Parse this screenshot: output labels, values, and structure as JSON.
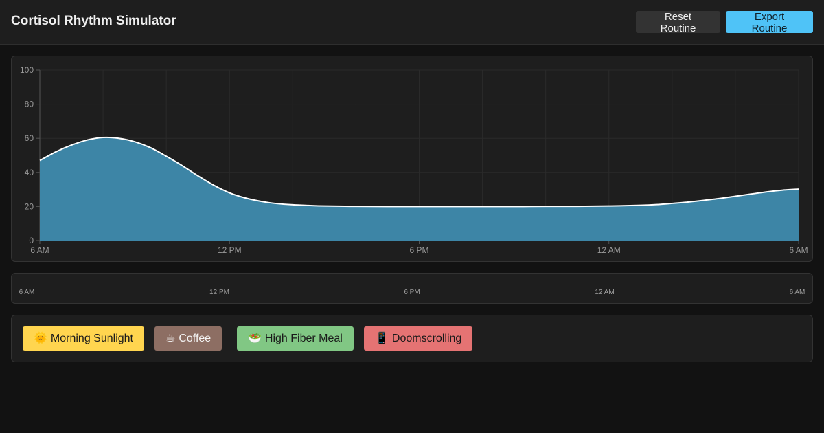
{
  "app": {
    "title": "Cortisol Rhythm Simulator"
  },
  "toolbar": {
    "reset_label": "Reset Routine",
    "export_label": "Export Routine"
  },
  "colors": {
    "accent": "#4fc3f7",
    "area_fill": "#3d85a6",
    "curve_stroke": "#ffffff",
    "sunlight": "#ffd54f",
    "coffee": "#8d6e63",
    "fiber": "#81c784",
    "doom": "#e57373"
  },
  "chart_data": {
    "type": "area",
    "title": "",
    "xlabel": "",
    "ylabel": "",
    "ylim": [
      0,
      100
    ],
    "yticks": [
      0,
      20,
      40,
      60,
      80,
      100
    ],
    "xlim": [
      0,
      24
    ],
    "xticks": [
      {
        "x": 0,
        "label": "6 AM"
      },
      {
        "x": 6,
        "label": "12 PM"
      },
      {
        "x": 12,
        "label": "6 PM"
      },
      {
        "x": 18,
        "label": "12 AM"
      },
      {
        "x": 24,
        "label": "6 AM"
      }
    ],
    "grid": true,
    "series": [
      {
        "x": [
          0,
          0.5,
          1,
          1.5,
          2,
          2.5,
          3,
          3.5,
          4,
          4.5,
          5,
          5.5,
          6,
          6.5,
          7,
          7.5,
          8,
          8.5,
          9,
          10,
          11,
          12,
          13,
          14,
          15,
          16,
          17,
          18,
          19,
          19.5,
          20,
          20.5,
          21,
          21.5,
          22,
          22.5,
          23,
          23.5,
          24
        ],
        "values": [
          47,
          52,
          56,
          59,
          60.5,
          60,
          58,
          54.5,
          49.5,
          44,
          38,
          32.5,
          28,
          25,
          23,
          21.7,
          21,
          20.6,
          20.3,
          20.1,
          20,
          20,
          20,
          20,
          20,
          20.1,
          20.1,
          20.3,
          20.7,
          21.1,
          21.8,
          22.6,
          23.6,
          24.7,
          26,
          27.3,
          28.6,
          29.6,
          30.2
        ]
      }
    ]
  },
  "timeline": {
    "labels": [
      {
        "x": 0,
        "label": "6 AM"
      },
      {
        "x": 6,
        "label": "12 PM"
      },
      {
        "x": 12,
        "label": "6 PM"
      },
      {
        "x": 18,
        "label": "12 AM"
      },
      {
        "x": 24,
        "label": "6 AM"
      }
    ]
  },
  "palette": {
    "items": [
      {
        "icon": "🌞",
        "icon_name": "sun-icon",
        "label": "Morning Sunlight"
      },
      {
        "icon": "☕",
        "icon_name": "coffee-cup-icon",
        "label": "Coffee"
      },
      {
        "icon": "🥗",
        "icon_name": "salad-bowl-icon",
        "label": "High Fiber Meal"
      },
      {
        "icon": "📱",
        "icon_name": "phone-icon",
        "label": "Doomscrolling"
      }
    ]
  }
}
